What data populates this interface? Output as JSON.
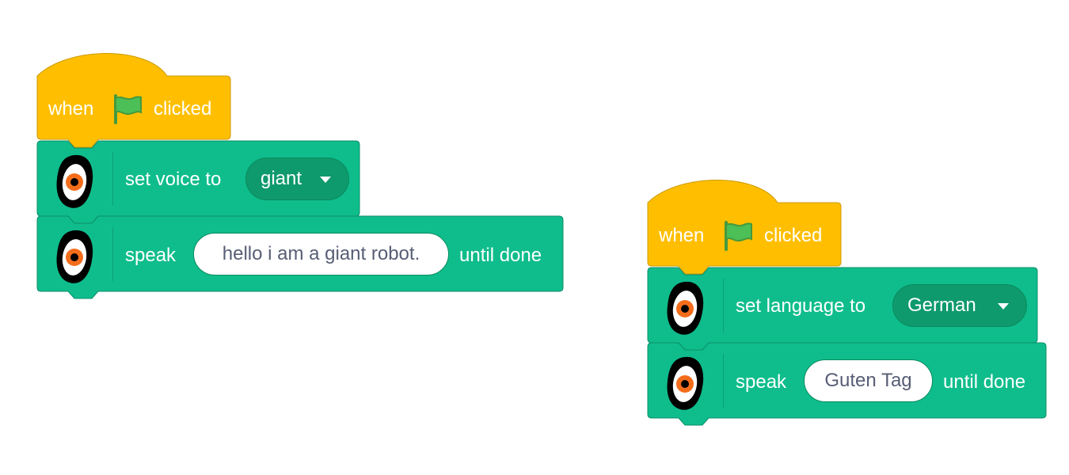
{
  "colors": {
    "event_fill": "#ffbf00",
    "event_stroke": "#cc9900",
    "extension_fill": "#0fbd8c",
    "extension_stroke": "#0b8e69",
    "flag_green": "#4cbf56",
    "eye_orange": "#f46d1b"
  },
  "scripts": [
    {
      "hat": {
        "when": "when",
        "flag_icon": "green-flag-icon",
        "clicked": "clicked"
      },
      "blocks": [
        {
          "icon": "text-to-speech-icon",
          "label": "set voice to",
          "dropdown": "giant"
        },
        {
          "icon": "text-to-speech-icon",
          "label": "speak",
          "input": "hello i am a giant robot.",
          "suffix": "until done"
        }
      ]
    },
    {
      "hat": {
        "when": "when",
        "flag_icon": "green-flag-icon",
        "clicked": "clicked"
      },
      "blocks": [
        {
          "icon": "text-to-speech-icon",
          "label": "set language to",
          "dropdown": "German"
        },
        {
          "icon": "text-to-speech-icon",
          "label": "speak",
          "input": "Guten Tag",
          "suffix": "until done"
        }
      ]
    }
  ]
}
